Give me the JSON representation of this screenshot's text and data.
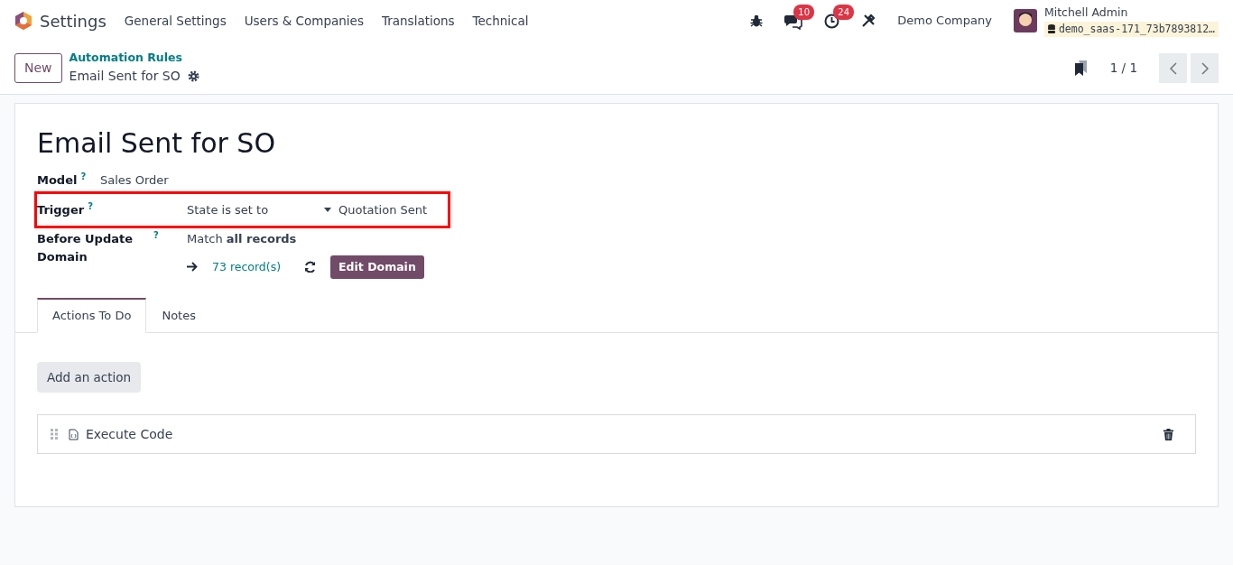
{
  "navbar": {
    "app_title": "Settings",
    "menu": [
      "General Settings",
      "Users & Companies",
      "Translations",
      "Technical"
    ],
    "messages_count": "10",
    "activities_count": "24",
    "company": "Demo Company",
    "user_name": "Mitchell Admin",
    "database": "demo_saas-171_73b7893812…"
  },
  "control_panel": {
    "new_button": "New",
    "breadcrumb": "Automation Rules",
    "record": "Email Sent for SO",
    "pager": "1 / 1"
  },
  "form": {
    "title": "Email Sent for SO",
    "fields": [
      {
        "kind": "text",
        "label": "Model",
        "help": "?",
        "value": "Sales Order",
        "highlighted": false
      },
      {
        "kind": "trigger",
        "label": "Trigger",
        "help": "?",
        "value": "State is set to",
        "value_2": "Quotation Sent",
        "highlighted": true
      },
      {
        "kind": "domain",
        "label": "Before Update Domain",
        "help": "?",
        "value": "Match **all records**",
        "records": "73 record(s)",
        "button": "Edit Domain",
        "highlighted": false
      }
    ],
    "tabs": [
      {
        "label": "Actions To Do",
        "selected": true
      },
      {
        "label": "Notes",
        "selected": false
      }
    ],
    "add_button": "Add an action",
    "actions": [
      {
        "label": "Execute Code"
      }
    ]
  }
}
